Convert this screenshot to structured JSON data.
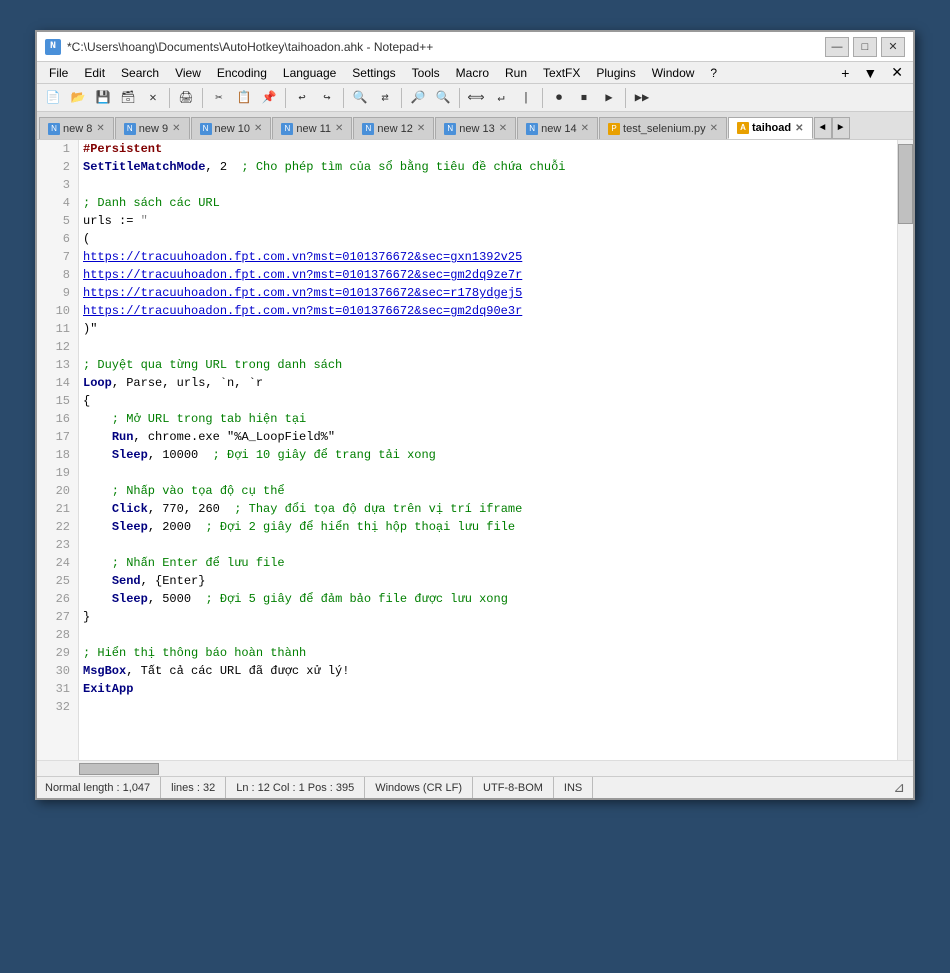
{
  "window": {
    "title": "*C:\\Users\\hoang\\Documents\\AutoHotkey\\taihoadon.ahk - Notepad++",
    "icon_label": "N"
  },
  "title_buttons": {
    "minimize": "—",
    "maximize": "□",
    "close": "✕"
  },
  "menu": {
    "items": [
      "File",
      "Edit",
      "Search",
      "View",
      "Encoding",
      "Language",
      "Settings",
      "Tools",
      "Macro",
      "Run",
      "TextFX",
      "Plugins",
      "Window",
      "?"
    ],
    "right_items": [
      "+",
      "▼",
      "✕"
    ]
  },
  "tabs": [
    {
      "label": "new 8",
      "active": false
    },
    {
      "label": "new 9",
      "active": false
    },
    {
      "label": "new 10",
      "active": false
    },
    {
      "label": "new 11",
      "active": false
    },
    {
      "label": "new 12",
      "active": false
    },
    {
      "label": "new 13",
      "active": false
    },
    {
      "label": "new 14",
      "active": false
    },
    {
      "label": "test_selenium.py",
      "active": false
    },
    {
      "label": "taihoad",
      "active": true
    }
  ],
  "status_bar": {
    "normal_length": "Normal length : 1,047",
    "lines": "lines : 32",
    "ln_col_pos": "Ln : 12   Col : 1   Pos : 395",
    "line_ending": "Windows (CR LF)",
    "encoding": "UTF-8-BOM",
    "ins": "INS"
  },
  "code_lines": [
    {
      "num": 1,
      "content": "#Persistent"
    },
    {
      "num": 2,
      "content": "SetTitleMatchMode, 2  ; Cho phép tìm của sổ bằng tiêu đề chứa chuỗi"
    },
    {
      "num": 3,
      "content": ""
    },
    {
      "num": 4,
      "content": "; Danh sách các URL"
    },
    {
      "num": 5,
      "content": "urls := \""
    },
    {
      "num": 6,
      "content": "("
    },
    {
      "num": 7,
      "content": "https://tracuuhoadon.fpt.com.vn?mst=0101376672&sec=gxn1392v25"
    },
    {
      "num": 8,
      "content": "https://tracuuhoadon.fpt.com.vn?mst=0101376672&sec=gm2dq9ze7r"
    },
    {
      "num": 9,
      "content": "https://tracuuhoadon.fpt.com.vn?mst=0101376672&sec=r178ydgej5"
    },
    {
      "num": 10,
      "content": "https://tracuuhoadon.fpt.com.vn?mst=0101376672&sec=gm2dq90e3r"
    },
    {
      "num": 11,
      "content": ")\""
    },
    {
      "num": 12,
      "content": ""
    },
    {
      "num": 13,
      "content": "; Duyệt qua từng URL trong danh sách"
    },
    {
      "num": 14,
      "content": "Loop, Parse, urls, `n, `r"
    },
    {
      "num": 15,
      "content": "{"
    },
    {
      "num": 16,
      "content": "    ; Mở URL trong tab hiện tại"
    },
    {
      "num": 17,
      "content": "    Run, chrome.exe \"%A_LoopField%\""
    },
    {
      "num": 18,
      "content": "    Sleep, 10000  ; Đợi 10 giây để trang tải xong"
    },
    {
      "num": 19,
      "content": ""
    },
    {
      "num": 20,
      "content": "    ; Nhấp vào tọa độ cụ thể"
    },
    {
      "num": 21,
      "content": "    Click, 770, 260  ; Thay đổi tọa độ dựa trên vị trí iframe"
    },
    {
      "num": 22,
      "content": "    Sleep, 2000  ; Đợi 2 giây để hiển thị hộp thoại lưu file"
    },
    {
      "num": 23,
      "content": ""
    },
    {
      "num": 24,
      "content": "    ; Nhấn Enter để lưu file"
    },
    {
      "num": 25,
      "content": "    Send, {Enter}"
    },
    {
      "num": 26,
      "content": "    Sleep, 5000  ; Đợi 5 giây để đảm bảo file được lưu xong"
    },
    {
      "num": 27,
      "content": "}"
    },
    {
      "num": 28,
      "content": ""
    },
    {
      "num": 29,
      "content": "; Hiển thị thông báo hoàn thành"
    },
    {
      "num": 30,
      "content": "MsgBox, Tất cả các URL đã được xử lý!"
    },
    {
      "num": 31,
      "content": "ExitApp"
    },
    {
      "num": 32,
      "content": ""
    }
  ]
}
